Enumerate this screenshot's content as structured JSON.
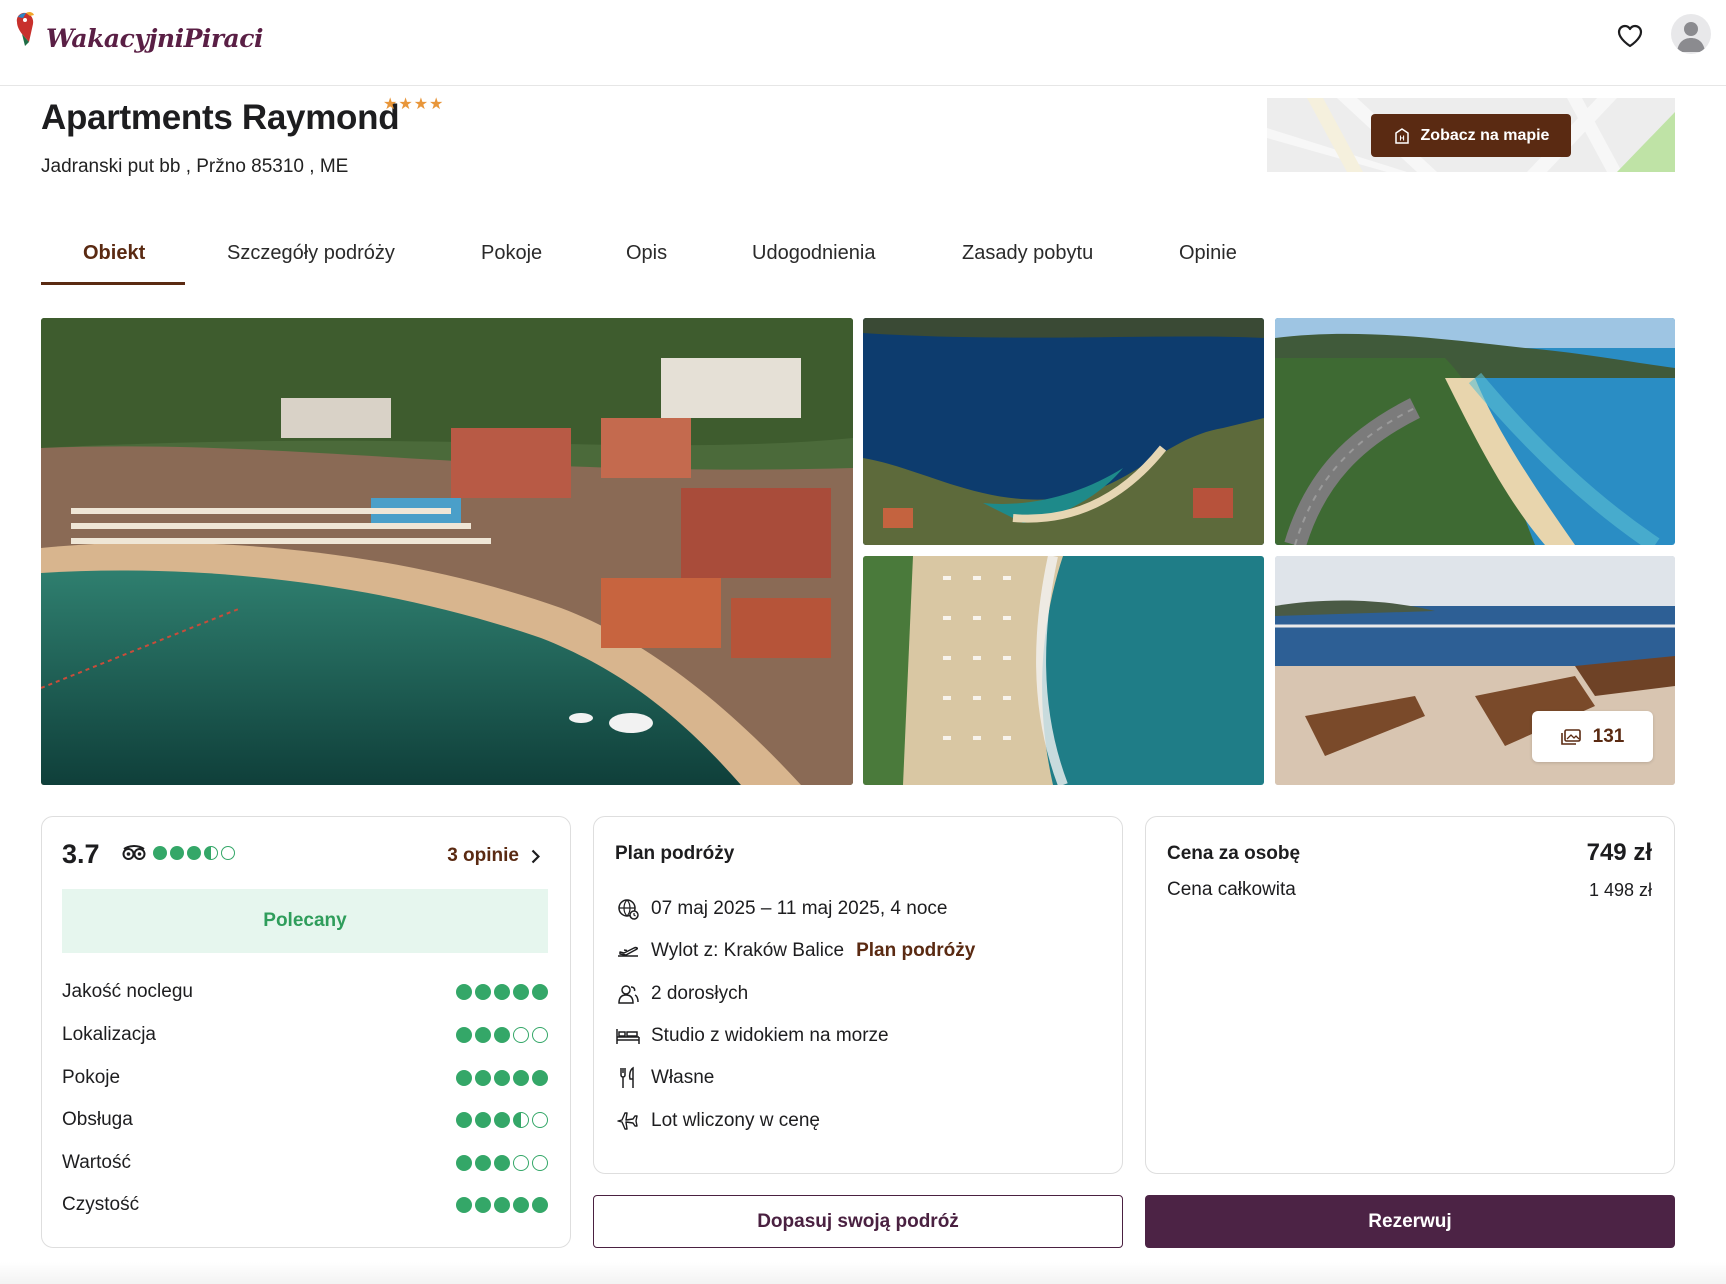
{
  "brand": {
    "name": "WakacyjniPiraci",
    "accent": "#5a2a12",
    "primary": "#4c2345",
    "green": "#34a768"
  },
  "header": {
    "icons": [
      "heart-icon",
      "user-avatar-icon"
    ]
  },
  "hotel": {
    "name": "Apartments Raymond",
    "stars": 4,
    "stars_text": "★★★★",
    "address": "Jadranski put bb , Pržno 85310 , ME",
    "map_button": "Zobacz na mapie"
  },
  "tabs": [
    {
      "label": "Obiekt",
      "active": true
    },
    {
      "label": "Szczegóły podróży",
      "active": false
    },
    {
      "label": "Pokoje",
      "active": false
    },
    {
      "label": "Opis",
      "active": false
    },
    {
      "label": "Udogodnienia",
      "active": false
    },
    {
      "label": "Zasady pobytu",
      "active": false
    },
    {
      "label": "Opinie",
      "active": false
    }
  ],
  "gallery": {
    "photo_count": "131"
  },
  "rating": {
    "score": "3.7",
    "tripadvisor_bubbles": 3.5,
    "reviews_link": "3 opinie",
    "badge": "Polecany",
    "categories": [
      {
        "label": "Jakość noclegu",
        "value": 5
      },
      {
        "label": "Lokalizacja",
        "value": 3
      },
      {
        "label": "Pokoje",
        "value": 5
      },
      {
        "label": "Obsługa",
        "value": 3.5
      },
      {
        "label": "Wartość",
        "value": 3
      },
      {
        "label": "Czystość",
        "value": 5
      }
    ]
  },
  "plan": {
    "title": "Plan podróży",
    "dates": "07 maj 2025 – 11 maj 2025, 4 noce",
    "departure": "Wylot z: Kraków Balice",
    "departure_link": "Plan podróży",
    "travelers": "2 dorosłych",
    "room": "Studio z widokiem na morze",
    "board": "Własne",
    "flight": "Lot wliczony w cenę"
  },
  "price": {
    "per_person_label": "Cena za osobę",
    "per_person_value": "749 zł",
    "total_label": "Cena całkowita",
    "total_value": "1 498 zł"
  },
  "actions": {
    "customize": "Dopasuj swoją podróż",
    "book": "Rezerwuj"
  }
}
